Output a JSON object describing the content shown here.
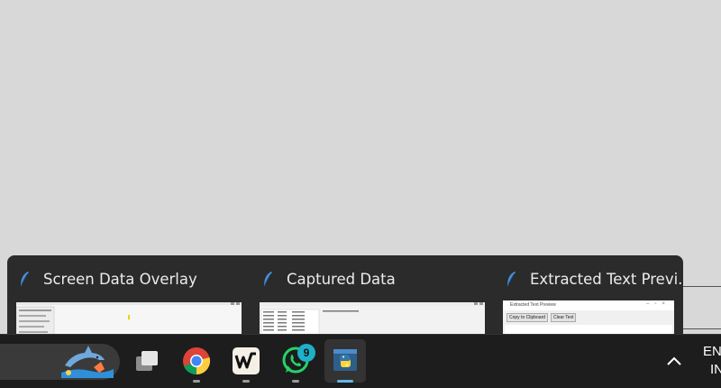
{
  "previews": [
    {
      "title": "Screen Data Overlay"
    },
    {
      "title": "Captured Data"
    },
    {
      "title": "Extracted Text Previ..."
    }
  ],
  "thumb3": {
    "window_title": "Extracted Text Preview",
    "copy_label": "Copy to Clipboard",
    "clear_label": "Clear Text"
  },
  "taskbar": {
    "items": [
      {
        "name": "task-view",
        "icon": "task-view-icon"
      },
      {
        "name": "chrome",
        "icon": "chrome-icon"
      },
      {
        "name": "writer",
        "icon": "w-app-icon"
      },
      {
        "name": "whatsapp",
        "icon": "whatsapp-icon",
        "badge": "9"
      },
      {
        "name": "python",
        "icon": "python-icon",
        "active": true
      }
    ],
    "lang_line1": "EN",
    "lang_line2": "IN"
  },
  "colors": {
    "taskbar_bg": "#1d1d1d",
    "preview_bg": "#2b2b2b",
    "desktop_bg": "#d8d8d8",
    "active_indicator": "#5fb8e6",
    "badge": "#1fb0c9"
  }
}
